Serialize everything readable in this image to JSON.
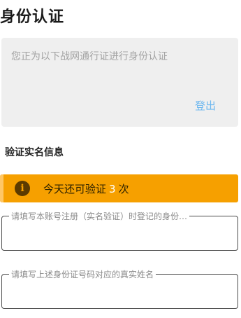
{
  "page": {
    "title": "身份认证"
  },
  "account": {
    "message": "您正为以下战网通行证进行身份认证",
    "logout_label": "登出"
  },
  "section": {
    "title": "验证实名信息"
  },
  "warning": {
    "icon": "info-icon",
    "text_before": "今天还可验证",
    "count": "3",
    "text_after": "次",
    "background_color": "#f6a000"
  },
  "form": {
    "id_field": {
      "label": "请填写本账号注册（实名验证）时登记的身份…",
      "value": ""
    },
    "name_field": {
      "label": "请填写上述身份证号码对应的真实姓名",
      "value": ""
    }
  },
  "colors": {
    "link": "#6fb8ef",
    "card_background": "#efefef",
    "field_border": "#4a4a4a"
  }
}
